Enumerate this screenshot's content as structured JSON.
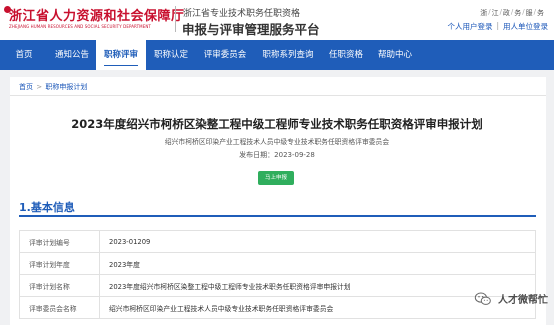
{
  "header": {
    "logo_cn": "浙江省人力资源和社会保障厅",
    "logo_en": "ZHEJIANG HUMAN RESOURCES AND SOCIAL SECURITY DEPARTMENT",
    "system_subtitle": "浙江省专业技术职务任职资格",
    "system_title": "申报与评审管理服务平台",
    "province_chars": [
      "浙",
      "江",
      "政",
      "务",
      "服",
      "务"
    ],
    "personal_login": "个人用户登录",
    "unit_login": "用人单位登录"
  },
  "nav": {
    "items": [
      {
        "label": "首页",
        "active": false
      },
      {
        "label": "通知公告",
        "active": false
      },
      {
        "label": "职称评审",
        "active": true
      },
      {
        "label": "职称认定",
        "active": false
      },
      {
        "label": "评审委员会",
        "active": false
      },
      {
        "label": "职称系列查询",
        "active": false
      },
      {
        "label": "任职资格",
        "active": false
      },
      {
        "label": "帮助中心",
        "active": false
      }
    ]
  },
  "breadcrumb": {
    "home": "首页",
    "separator": ">",
    "current": "职称申报计划"
  },
  "article": {
    "title": "2023年度绍兴市柯桥区染整工程中级工程师专业技术职务任职资格评审申报计划",
    "committee": "绍兴市柯桥区印染产业工程技术人员中级专业技术职务任职资格评审委员会",
    "publish_date": "发布日期：2023-09-28",
    "apply_button": "马上申报"
  },
  "section": {
    "title": "1.基本信息"
  },
  "table": {
    "rows": [
      {
        "key": "评审计划编号",
        "value": "2023-01209"
      },
      {
        "key": "评审计划年度",
        "value": "2023年度"
      },
      {
        "key": "评审计划名称",
        "value": "2023年度绍兴市柯桥区染整工程中级工程师专业技术职务任职资格评审申报计划"
      },
      {
        "key": "评审委员会名称",
        "value": "绍兴市柯桥区印染产业工程技术人员中级专业技术职务任职资格评审委员会"
      }
    ]
  },
  "watermark": {
    "text": "人才微帮忙",
    "icon": "wechat-icon"
  },
  "colors": {
    "nav_blue": "#1f5db9",
    "brand_red": "#c8102e",
    "button_green": "#2fae5d",
    "link_blue": "#1a56b8"
  }
}
